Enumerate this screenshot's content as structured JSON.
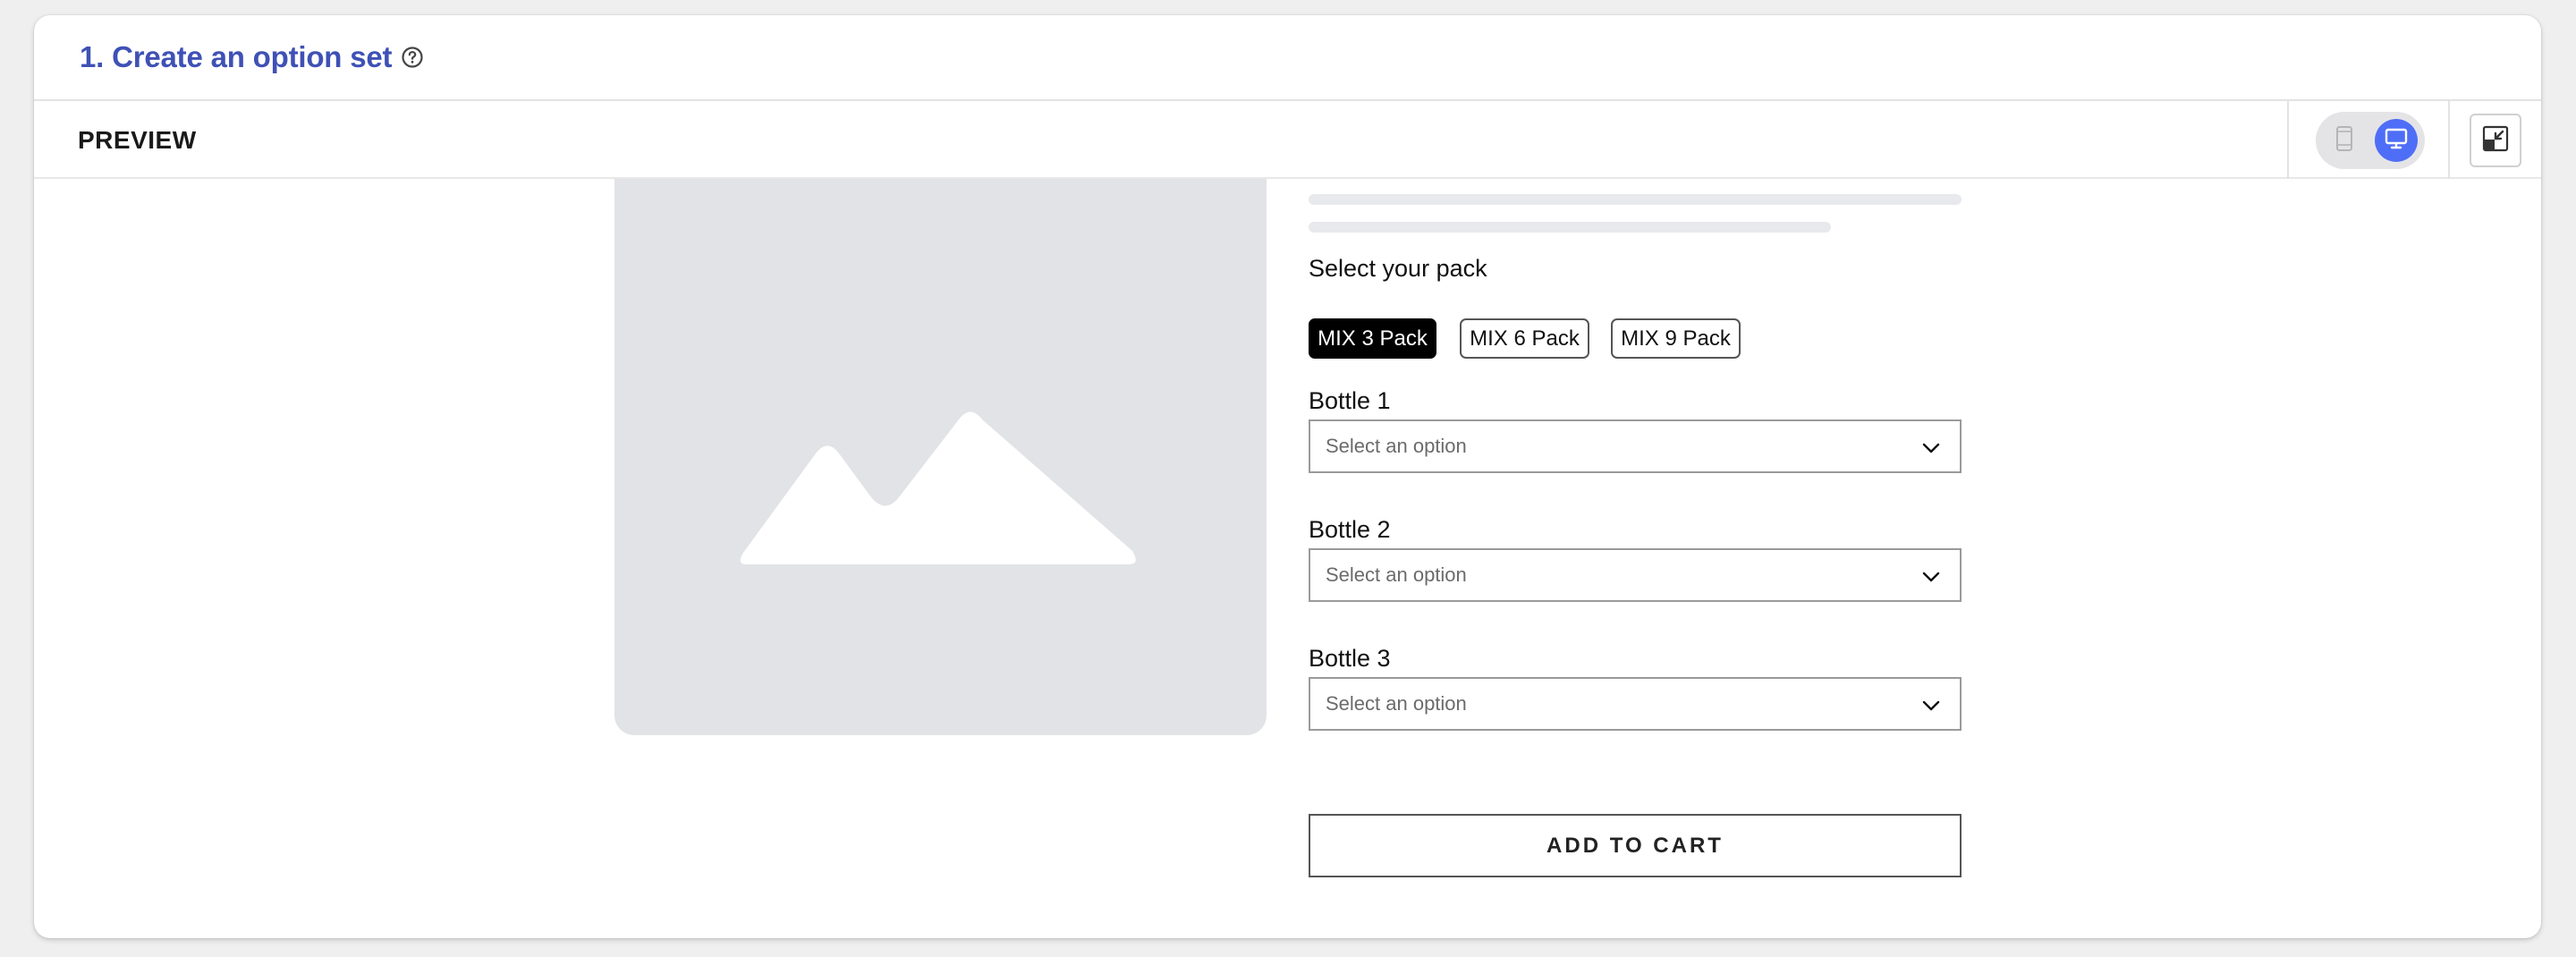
{
  "header": {
    "title": "1. Create an option set",
    "help_icon": "question-circle-icon"
  },
  "preview_bar": {
    "label": "PREVIEW",
    "device_toggle": {
      "mobile_icon": "mobile-phone-icon",
      "desktop_icon": "desktop-monitor-icon",
      "selected": "desktop"
    },
    "collapse_icon": "minimize-window-icon"
  },
  "product": {
    "image_icon": "image-placeholder-icon",
    "pack_label": "Select your pack",
    "packs": [
      {
        "label": "MIX 3 Pack",
        "selected": true
      },
      {
        "label": "MIX 6 Pack",
        "selected": false
      },
      {
        "label": "MIX 9 Pack",
        "selected": false
      }
    ],
    "bottles": [
      {
        "label": "Bottle 1",
        "placeholder": "Select an option"
      },
      {
        "label": "Bottle 2",
        "placeholder": "Select an option"
      },
      {
        "label": "Bottle 3",
        "placeholder": "Select an option"
      }
    ],
    "add_to_cart": "ADD TO CART"
  },
  "colors": {
    "accent": "#3f51b5",
    "toggle_active": "#4f6ef7",
    "selected_pack": "#000000",
    "placeholder_bg": "#e2e3e6"
  }
}
